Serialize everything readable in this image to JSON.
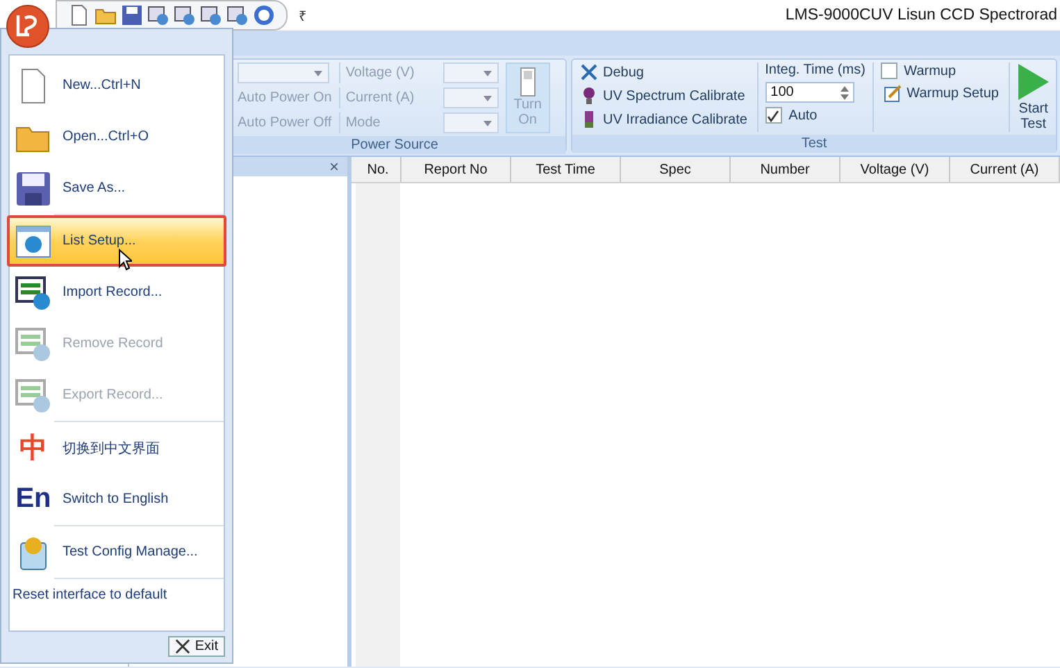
{
  "title_bar": {
    "title": "LMS-9000CUV Lisun CCD Spectrorad",
    "menu_glyph": "₹"
  },
  "ribbon": {
    "power_source": {
      "label": "Power Source",
      "disabled": true,
      "options": [
        "Auto Power On",
        "Auto Power Off"
      ],
      "fields": [
        {
          "label": "Voltage (V)"
        },
        {
          "label": "Current (A)"
        },
        {
          "label": "Mode"
        }
      ],
      "toggle_button": "Turn On"
    },
    "test": {
      "label": "Test",
      "actions": [
        {
          "label": "Debug"
        },
        {
          "label": "UV Spectrum Calibrate"
        },
        {
          "label": "UV Irradiance Calibrate"
        }
      ],
      "integ_time": {
        "label": "Integ. Time (ms)",
        "value": "100"
      },
      "auto": {
        "label": "Auto",
        "checked": true
      },
      "warmup": {
        "label": "Warmup",
        "checked": false
      },
      "warmup_setup": "Warmup Setup",
      "start_button": "Start Test"
    }
  },
  "left_pane": {
    "close": "×"
  },
  "table": {
    "columns": [
      "No.",
      "Report No",
      "Test Time",
      "Spec",
      "Number",
      "Voltage (V)",
      "Current (A)"
    ]
  },
  "app_menu": {
    "items": [
      {
        "label": "New...Ctrl+N",
        "disabled": false,
        "selected": false
      },
      {
        "label": "Open...Ctrl+O",
        "disabled": false,
        "selected": false
      },
      {
        "label": "Save As...",
        "disabled": false,
        "selected": false
      },
      {
        "label": "List Setup...",
        "disabled": false,
        "selected": true
      },
      {
        "label": "Import Record...",
        "disabled": false,
        "selected": false
      },
      {
        "label": "Remove Record",
        "disabled": true,
        "selected": false
      },
      {
        "label": "Export Record...",
        "disabled": true,
        "selected": false
      },
      {
        "label": "切换到中文界面",
        "disabled": false,
        "selected": false
      },
      {
        "label": "Switch to English",
        "disabled": false,
        "selected": false
      },
      {
        "label": "Test Config Manage...",
        "disabled": false,
        "selected": false
      }
    ],
    "reset_link": "Reset interface to default",
    "exit_button": "Exit",
    "zh_glyph": "中",
    "en_glyph": "En"
  }
}
